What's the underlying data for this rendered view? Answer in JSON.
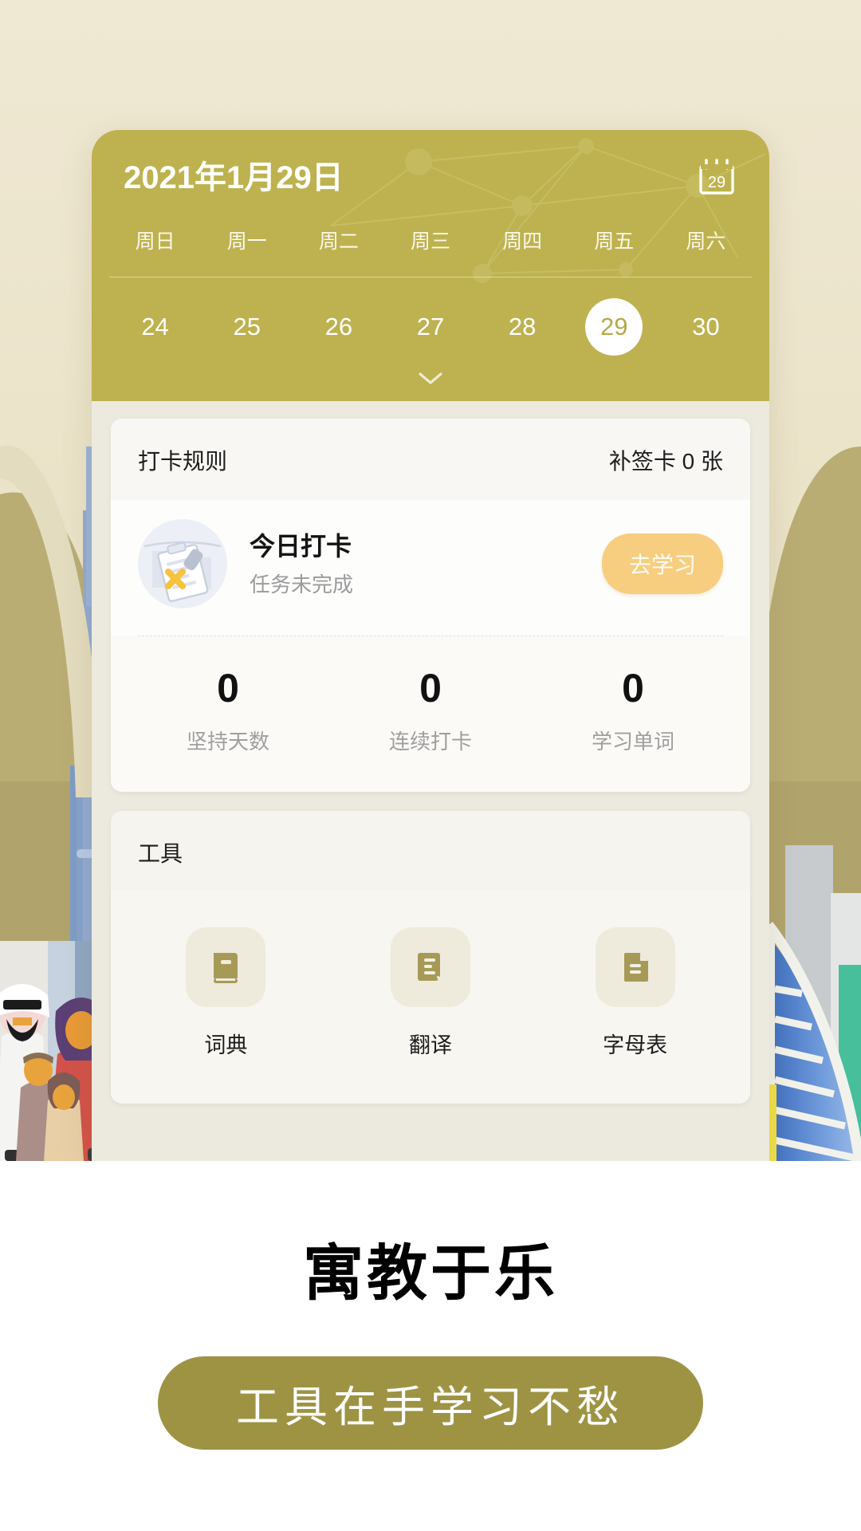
{
  "theme": {
    "page_bg": "#ffffff",
    "hero_bg": "#eae2c6",
    "calendar_header_bg": "#bdb24f",
    "accent_olive": "#9d9343",
    "accent_yellow": "#f7ce80",
    "content_bg": "#ece9de",
    "card_bg": "#fbfaf7"
  },
  "calendar": {
    "title": "2021年1月29日",
    "calendar_icon": "calendar-29-icon",
    "calendar_icon_day": "29",
    "weekdays": [
      "周日",
      "周一",
      "周二",
      "周三",
      "周四",
      "周五",
      "周六"
    ],
    "days": [
      {
        "num": "24",
        "selected": false
      },
      {
        "num": "25",
        "selected": false
      },
      {
        "num": "26",
        "selected": false
      },
      {
        "num": "27",
        "selected": false
      },
      {
        "num": "28",
        "selected": false
      },
      {
        "num": "29",
        "selected": true
      },
      {
        "num": "30",
        "selected": false
      }
    ],
    "expand_icon": "chevron-down-icon"
  },
  "checkin_card": {
    "rules_label": "打卡规则",
    "makeup_card_label": "补签卡 0 张",
    "today": {
      "icon": "clipboard-task-icon",
      "title": "今日打卡",
      "subtitle": "任务未完成",
      "action_label": "去学习"
    },
    "stats": [
      {
        "value": "0",
        "label": "坚持天数"
      },
      {
        "value": "0",
        "label": "连续打卡"
      },
      {
        "value": "0",
        "label": "学习单词"
      }
    ]
  },
  "tools_card": {
    "title": "工具",
    "items": [
      {
        "icon": "book-icon",
        "label": "词典"
      },
      {
        "icon": "translate-doc-icon",
        "label": "翻译"
      },
      {
        "icon": "document-icon",
        "label": "字母表"
      }
    ]
  },
  "promo": {
    "headline": "寓教于乐",
    "pill_label": "工具在手学习不愁"
  }
}
